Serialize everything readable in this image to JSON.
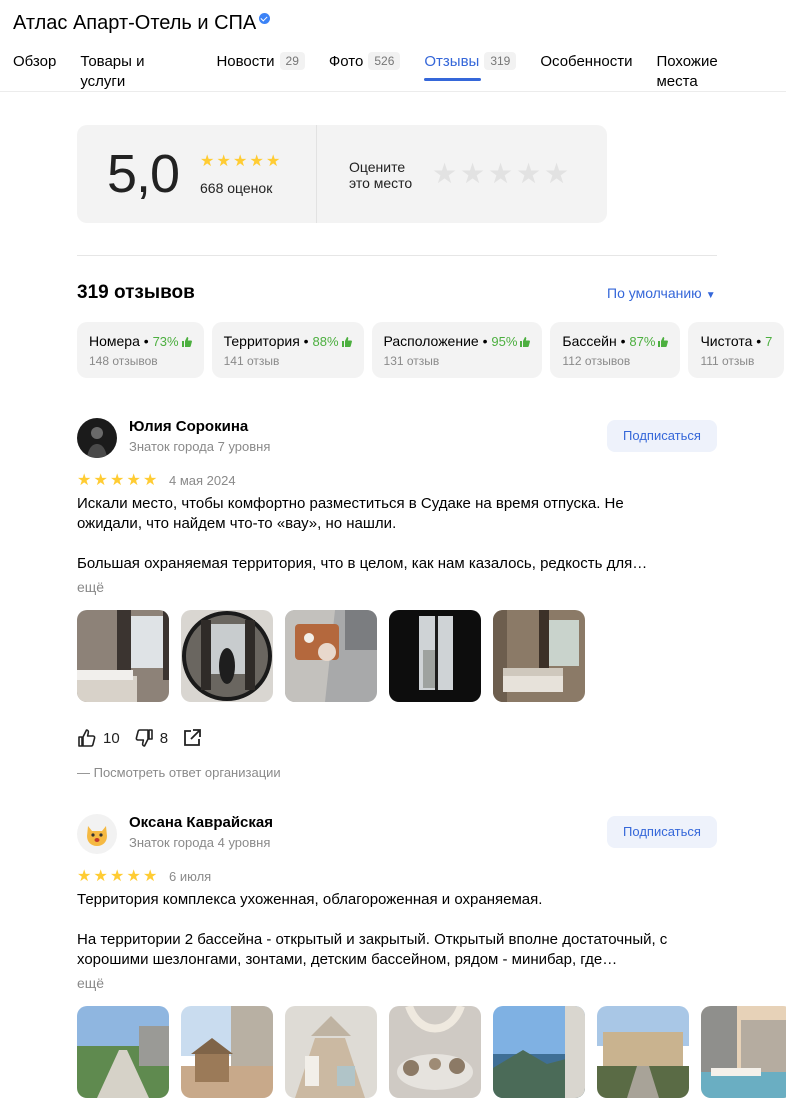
{
  "header": {
    "title": "Атлас Апарт-Отель и СПА"
  },
  "tabs": [
    {
      "label": "Обзор",
      "count": ""
    },
    {
      "label": "Товары и услуги",
      "count": ""
    },
    {
      "label": "Новости",
      "count": "29"
    },
    {
      "label": "Фото",
      "count": "526"
    },
    {
      "label": "Отзывы",
      "count": "319"
    },
    {
      "label": "Особенности",
      "count": ""
    },
    {
      "label": "Похожие места",
      "count": ""
    }
  ],
  "rating": {
    "score": "5,0",
    "stars": 5,
    "count_label": "668 оценок",
    "rate_label": "Оцените\nэто место"
  },
  "reviews_header": {
    "title": "319 отзывов",
    "sort_label": "По умолчанию"
  },
  "aspects": [
    {
      "name": "Номера",
      "percent": "73%",
      "count": "148 отзывов"
    },
    {
      "name": "Территория",
      "percent": "88%",
      "count": "141 отзыв"
    },
    {
      "name": "Расположение",
      "percent": "95%",
      "count": "131 отзыв"
    },
    {
      "name": "Бассейн",
      "percent": "87%",
      "count": "112 отзывов"
    },
    {
      "name": "Чистота",
      "percent": "7",
      "count": "111 отзыв"
    }
  ],
  "reviews": [
    {
      "author": "Юлия Сорокина",
      "level": "Знаток города 7 уровня",
      "subscribe_label": "Подписаться",
      "stars": 5,
      "date": "4 мая 2024",
      "text": "Искали место, чтобы комфортно разместиться в Судаке на время отпуска. Не ожидали, что найдем что-то «вау», но нашли.\n\nБольшая охраняемая территория, что в целом, как нам казалось, редкость для…",
      "more_label": "ещё",
      "likes": "10",
      "dislikes": "8",
      "answer_label": "—   Посмотреть ответ организации"
    },
    {
      "author": "Оксана Каврайская",
      "level": "Знаток города 4 уровня",
      "subscribe_label": "Подписаться",
      "stars": 5,
      "date": "6 июля",
      "text": "Территория комплекса ухоженная, облагороженная и охраняемая.\n\nНа территории 2 бассейна - открытый и закрытый. Открытый вполне достаточный, с хорошими шезлонгами, зонтами, детским бассейном, рядом - минибар, где…",
      "more_label": "ещё"
    }
  ],
  "colors": {
    "accent": "#3567d9",
    "star": "#ffcc33",
    "positive": "#4caf3f",
    "muted": "#8a8a8a"
  }
}
